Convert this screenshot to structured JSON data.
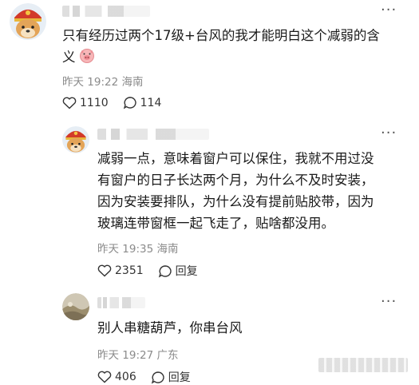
{
  "comments": [
    {
      "text_line1": "只有经历过两个17级+台风的我才能明白这个减弱的含",
      "text_line2": "义",
      "time": "昨天 19:22",
      "location": "海南",
      "likes": "1110",
      "replies": "114",
      "emoji_icon": "pig-face-emoji-icon"
    },
    {
      "text_lines": [
        "减弱一点，意味着窗户可以保住，我就不用过没",
        "有窗户的日子长达两个月，为什么不及时安装，",
        "因为安装要排队，为什么没有提前贴胶带，因为",
        "玻璃连带窗框一起飞走了，贴啥都没用。"
      ],
      "time": "昨天 19:35",
      "location": "海南",
      "likes": "2351",
      "reply_label": "回复"
    },
    {
      "text_lines": [
        "别人串糖葫芦，你串台风"
      ],
      "time": "昨天 19:27",
      "location": "广东",
      "likes": "406",
      "reply_label": "回复"
    }
  ],
  "icons": {
    "more": "more-icon",
    "like": "heart-icon",
    "comment": "comment-bubble-icon",
    "reply": "comment-bubble-icon"
  },
  "colors": {
    "meta": "#8b8b8b",
    "text": "#1a1a1a"
  }
}
